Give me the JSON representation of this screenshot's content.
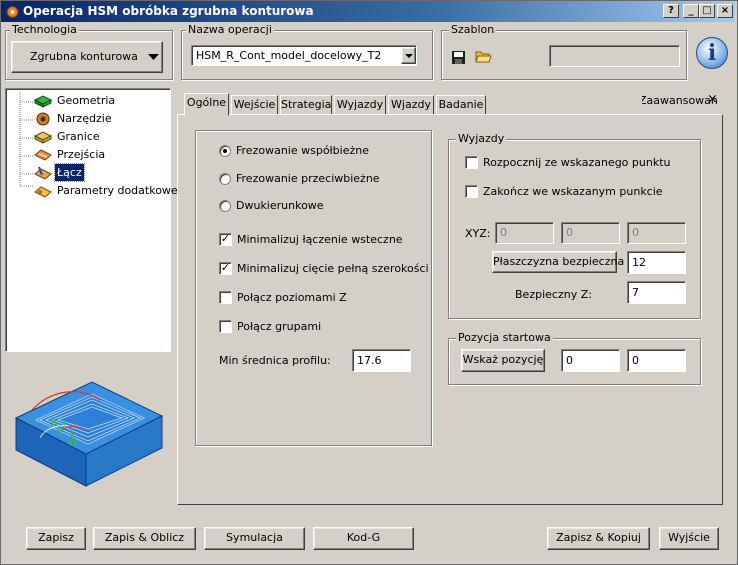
{
  "window": {
    "title": "Operacja HSM obróbka zgrubna konturowa",
    "help_btn": "?",
    "minimize_btn": "_",
    "maximize_btn": "□",
    "close_btn": "×"
  },
  "technologia": {
    "group_label": "Technologia",
    "button_label": "Zgrubna konturowa"
  },
  "nazwa_operacji": {
    "group_label": "Nazwa operacji",
    "value": "HSM_R_Cont_model_docelowy_T2"
  },
  "szablon": {
    "group_label": "Szablon",
    "value": ""
  },
  "info_icon_glyph": "i",
  "tree": {
    "items": [
      {
        "label": "Geometria",
        "icon": "geometry-icon"
      },
      {
        "label": "Narzędzie",
        "icon": "tool-icon"
      },
      {
        "label": "Granice",
        "icon": "boundaries-icon"
      },
      {
        "label": "Przejścia",
        "icon": "passes-icon"
      },
      {
        "label": "Łącz",
        "icon": "link-icon"
      },
      {
        "label": "Parametry dodatkowe",
        "icon": "parameters-icon"
      }
    ],
    "selected": "Łącz"
  },
  "tabs": {
    "items": [
      "Ogólne",
      "Wejście",
      "Strategia",
      "Wyjazdy",
      "Wjazdy",
      "Badanie"
    ],
    "active": "Ogólne",
    "advanced_label": "Zaawansowane"
  },
  "general": {
    "radio_options": [
      {
        "label": "Frezowanie współbieżne",
        "checked": true
      },
      {
        "label": "Frezowanie przeciwbieżne",
        "checked": false
      },
      {
        "label": "Dwukierunkowe",
        "checked": false
      }
    ],
    "check_options": [
      {
        "label": "Minimalizuj łączenie wsteczne",
        "checked": true,
        "mark": "✓"
      },
      {
        "label": "Minimalizuj cięcie pełną szerokości",
        "checked": true,
        "mark": "✓"
      },
      {
        "label": "Połącz poziomami Z",
        "checked": false,
        "mark": ""
      },
      {
        "label": "Połącz grupami",
        "checked": false,
        "mark": ""
      }
    ],
    "min_srednica_label": "Min średnica profilu:",
    "min_srednica_value": "17.6"
  },
  "wyjazdy": {
    "group_label": "Wyjazdy",
    "start_from_point": {
      "label": "Rozpocznij ze wskazanego punktu",
      "checked": false
    },
    "end_at_point": {
      "label": "Zakończ we wskazanym punkcie",
      "checked": false
    },
    "xyz_label": "XYZ:",
    "xyz_values": [
      "0",
      "0",
      "0"
    ],
    "safe_plane_button": "Płaszczyzna bezpieczna",
    "safe_plane_value": "12",
    "safe_z_label": "Bezpieczny Z:",
    "safe_z_value": "7"
  },
  "pozycja_startowa": {
    "group_label": "Pozycja startowa",
    "button_label": "Wskaż pozycję",
    "x_value": "0",
    "y_value": "0"
  },
  "footer": {
    "save": "Zapisz",
    "save_calc": "Zapis & Oblicz",
    "simulation": "Symulacja",
    "gcode": "Kod-G",
    "save_copy": "Zapisz & Kopiuj",
    "exit": "Wyjście"
  },
  "colors": {
    "titlebar_start": "#0a246a",
    "titlebar_end": "#a6caf0",
    "tree_selected": "#0a246a",
    "panel_bg": "#d4d0c8",
    "part_blue": "#2f86d6"
  }
}
